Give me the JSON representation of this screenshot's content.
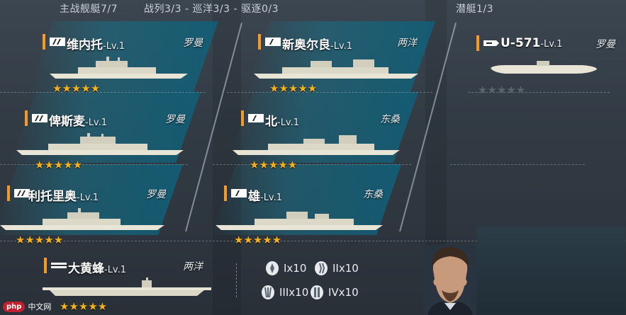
{
  "header": {
    "main_fleet": "主战舰艇7/7",
    "line_counts": "战列3/3 - 巡洋3/3 - 驱逐0/3",
    "submarine": "潜艇1/3"
  },
  "ships": [
    {
      "name": "维内托",
      "level": "-Lv.1",
      "nation": "罗曼",
      "stars": "★★★★★"
    },
    {
      "name": "俾斯麦",
      "level": "-Lv.1",
      "nation": "罗曼",
      "stars": "★★★★★"
    },
    {
      "name": "利托里奥",
      "level": "-Lv.1",
      "nation": "罗曼",
      "stars": "★★★★★"
    },
    {
      "name": "新奥尔良",
      "level": "-Lv.1",
      "nation": "两洋",
      "stars": "★★★★★"
    },
    {
      "name": "北",
      "level": "-Lv.1",
      "nation": "东桑",
      "stars": "★★★★★"
    },
    {
      "name": "雄",
      "level": "-Lv.1",
      "nation": "东桑",
      "stars": "★★★★★"
    },
    {
      "name": "U-571",
      "level": "-Lv.1",
      "nation": "罗曼",
      "stars": "★★★★★"
    }
  ],
  "carrier": {
    "name": "大黄蜂",
    "level": "-Lv.1",
    "nation": "两洋",
    "stars": "★★★★★"
  },
  "ammo": [
    {
      "label": "Ix10"
    },
    {
      "label": "IIx10"
    },
    {
      "label": "IIIx10"
    },
    {
      "label": "IVx10"
    }
  ],
  "watermark": {
    "logo": "php",
    "text": "中文网"
  },
  "colors": {
    "accent": "#f39a2a",
    "star": "#f3b21f",
    "card": "#16708a"
  }
}
